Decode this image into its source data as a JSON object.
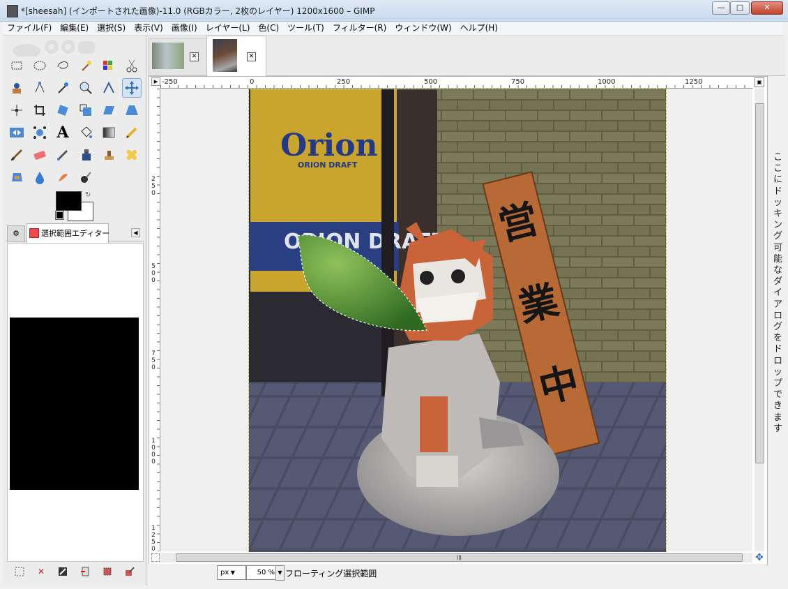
{
  "window": {
    "title": "*[sheesah] (インポートされた画像)-11.0 (RGBカラー, 2枚のレイヤー) 1200x1600 – GIMP",
    "minimize_icon": "minimize-icon",
    "maximize_icon": "maximize-icon",
    "close_icon": "close-icon"
  },
  "menubar": [
    "ファイル(F)",
    "編集(E)",
    "選択(S)",
    "表示(V)",
    "画像(I)",
    "レイヤー(L)",
    "色(C)",
    "ツール(T)",
    "フィルター(R)",
    "ウィンドウ(W)",
    "ヘルプ(H)"
  ],
  "toolbox": {
    "tools": [
      [
        "rect-select-icon",
        "ellipse-select-icon",
        "free-select-icon",
        "fuzzy-select-icon",
        "select-by-color-icon",
        "scissors-icon"
      ],
      [
        "foreground-select-icon",
        "paths-icon",
        "color-picker-icon",
        "zoom-icon",
        "measure-icon",
        "move-icon"
      ],
      [
        "align-icon",
        "crop-icon",
        "rotate-icon",
        "scale-icon",
        "shear-icon",
        "perspective-icon"
      ],
      [
        "flip-icon",
        "cage-transform-icon",
        "text-icon",
        "bucket-fill-icon",
        "blend-icon",
        "pencil-icon"
      ],
      [
        "paintbrush-icon",
        "eraser-icon",
        "airbrush-icon",
        "ink-icon",
        "clone-icon",
        "heal-icon"
      ],
      [
        "perspective-clone-icon",
        "blur-icon",
        "smudge-icon",
        "dodge-burn-icon"
      ]
    ],
    "active_tool": "move-icon",
    "foreground_color": "#000000",
    "background_color": "#ffffff"
  },
  "dock": {
    "tab_active_label": "選択範囲エディター",
    "bottom_buttons": [
      "select-all-icon",
      "select-none-icon",
      "invert-selection-icon",
      "save-to-channel-icon",
      "selection-to-path-icon",
      "stroke-selection-icon"
    ]
  },
  "image_tabs": [
    {
      "name": "thumbnail-1",
      "active": false
    },
    {
      "name": "thumbnail-2",
      "active": true
    }
  ],
  "rulers": {
    "horizontal": [
      "-250",
      "0",
      "250",
      "500",
      "750",
      "1000",
      "1250"
    ],
    "vertical": [
      "250",
      "500",
      "750",
      "1000",
      "1250"
    ]
  },
  "statusbar": {
    "unit": "px",
    "zoom": "50 %",
    "message": "フローティング選択範囲"
  },
  "canvas_labels": {
    "beer_brand": "Orion",
    "beer_sub": "ORION DRAFT",
    "beer_banner": "ORION DRAFT",
    "sign_text": "営業中"
  },
  "right_dock_hint": "ここにドッキング可能なダイアログをドロップできます"
}
